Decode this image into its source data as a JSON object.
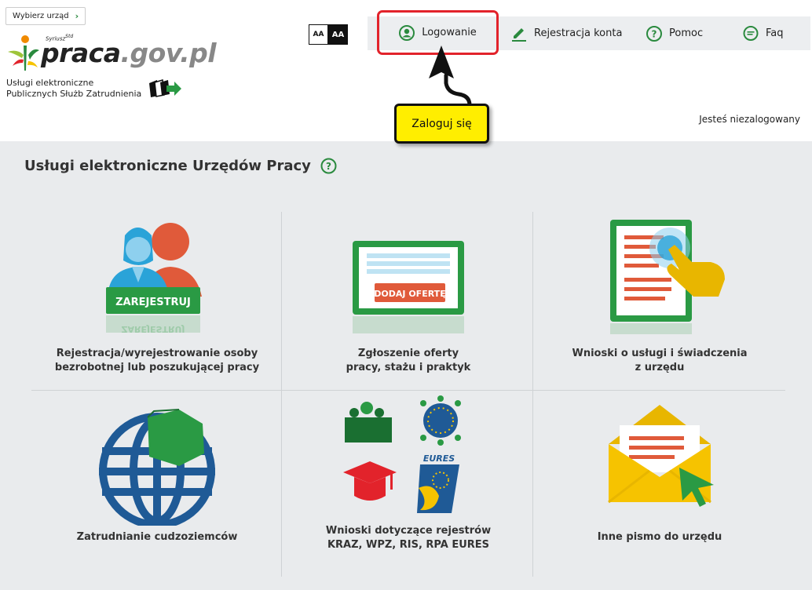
{
  "header": {
    "select_office_label": "Wybierz urząd",
    "logo": {
      "syriusz": "Syriusz",
      "syriusz_sup": "Std",
      "brand_main": "praca",
      "brand_gov": ".gov.pl"
    },
    "tagline_line1": "Usługi elektroniczne",
    "tagline_line2": "Publicznych Służb Zatrudnienia",
    "font_small": "AA",
    "font_large": "AA",
    "nav": {
      "login": "Logowanie",
      "register": "Rejestracja konta",
      "help": "Pomoc",
      "faq": "Faq"
    },
    "tooltip": "Zaloguj się",
    "login_status": "Jesteś niezalogowany"
  },
  "main": {
    "title": "Usługi elektroniczne Urzędów Pracy",
    "tiles": [
      {
        "line1": "Rejestracja/wyrejestrowanie osoby",
        "line2": "bezrobotnej lub poszukującej pracy",
        "art_text": "ZAREJESTRUJ",
        "art_reflection": "ZAREJESTRUJ"
      },
      {
        "line1": "Zgłoszenie oferty",
        "line2": "pracy, stażu i praktyk",
        "art_text": "DODAJ OFERTĘ"
      },
      {
        "line1": "Wnioski o usługi i świadczenia",
        "line2": "z urzędu"
      },
      {
        "line1": "Zatrudnianie cudzoziemców",
        "line2": ""
      },
      {
        "line1": "Wnioski dotyczące rejestrów",
        "line2": "KRAZ, WPZ, RIS, RPA EURES",
        "art_text": "EURES"
      },
      {
        "line1": "Inne pismo do urzędu",
        "line2": ""
      }
    ]
  },
  "colors": {
    "accent_green": "#2a8a3e",
    "highlight_red": "#e2232b",
    "tooltip_yellow": "#ffee00"
  }
}
